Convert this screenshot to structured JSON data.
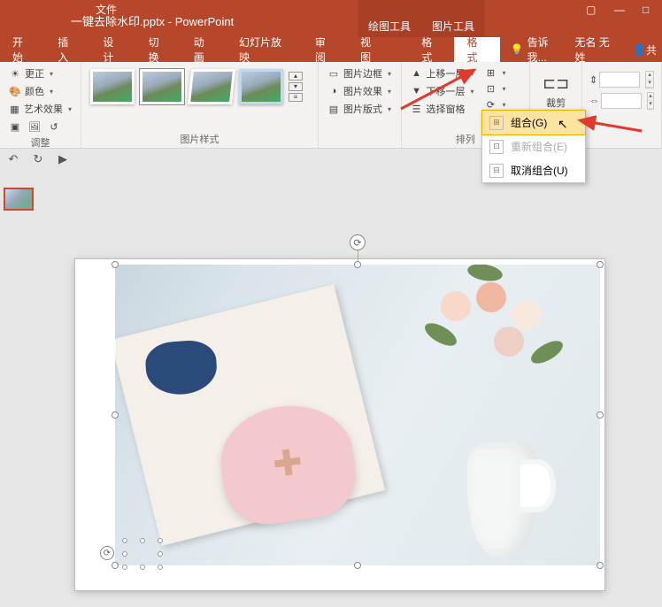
{
  "titlebar": {
    "file_menu": "文件",
    "title": "一键去除水印.pptx - PowerPoint",
    "tool_tab_draw": "绘图工具",
    "tool_tab_picture": "图片工具"
  },
  "tabs": {
    "start": "开始",
    "insert": "插入",
    "design": "设计",
    "transition": "切换",
    "animation": "动画",
    "slideshow": "幻灯片放映",
    "review": "审阅",
    "view": "视图",
    "format1": "格式",
    "format2": "格式",
    "tellme_icon": "💡",
    "tellme": "告诉我...",
    "user": "无名 无姓",
    "share": "共"
  },
  "ribbon": {
    "adjust": {
      "correct": "更正",
      "color": "颜色",
      "artistic": "艺术效果",
      "group_label": "调整"
    },
    "styles": {
      "group_label": "图片样式",
      "border": "图片边框",
      "effects": "图片效果",
      "layout": "图片版式"
    },
    "arrange": {
      "forward": "上移一层",
      "backward": "下移一层",
      "selection_pane": "选择窗格",
      "group_icon_drop": "▾",
      "group_label": "排列"
    },
    "size": {
      "crop": "裁剪",
      "height_val": "",
      "width_val": ""
    }
  },
  "menu": {
    "group": "组合(G)",
    "regroup": "重新组合(E)",
    "ungroup": "取消组合(U)"
  },
  "colors": {
    "accent": "#b7472a",
    "arrow": "#e03a2f"
  }
}
